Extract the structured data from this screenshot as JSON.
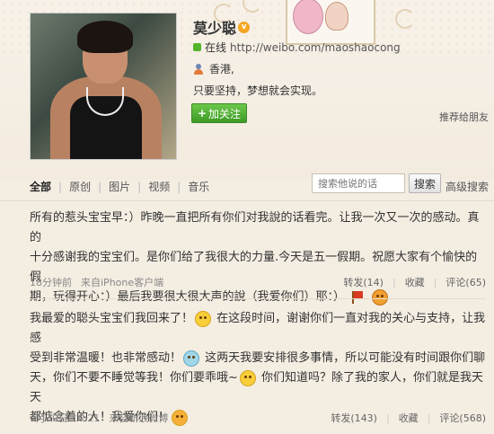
{
  "profile": {
    "name": "莫少聪",
    "verified_badge": "v",
    "online_label": "在线",
    "url": "http://weibo.com/maoshaocong",
    "location": "香港,",
    "bio": "只要坚持，梦想就会实现。",
    "follow_plus": "+",
    "follow_label": "加关注",
    "recommend_label": "推荐给朋友"
  },
  "filters": {
    "tabs": [
      "全部",
      "原创",
      "图片",
      "视频",
      "音乐"
    ],
    "search_placeholder": "搜索他说的话",
    "search_button": "搜索",
    "advanced_search": "高级搜索"
  },
  "posts": [
    {
      "lines": [
        "所有的惹头宝宝早：）昨晚一直把所有你们对我說的话看完。让我一次又一次的感动。真的",
        "十分感谢我的宝宝们。是你们给了我很大的力量.今天是五一假期。祝愿大家有个愉快的假",
        "期，玩得开心：）最后我要很大很大声的說（我爱你们）耶：）"
      ],
      "time": "18分钟前",
      "source": "来自iPhone客户端",
      "repost": "转发(14)",
      "favorite": "收藏",
      "comment": "评论(65)"
    },
    {
      "segments": [
        "我最爱的聪头宝宝们我回来了！",
        "在这段时间，谢谢你们一直对我的关心与支持，让我感",
        "受到非常温暖！也非常感动！",
        "这两天我要安排很多事情，所以可能没有时间跟你们聊",
        "天，你们不要不睡觉等我！你们要乖哦~",
        "你们知道吗？除了我的家人，你们就是我天天",
        "都惦念着的人！我爱你们！"
      ],
      "time": "4月30日 16:21",
      "source": "来自新浪微博",
      "repost": "转发(143)",
      "favorite": "收藏",
      "comment": "评论(568)"
    }
  ],
  "colors": {
    "background": "#f4ede2",
    "follow_green": "#3d9a26",
    "online_green": "#52b52b",
    "badge_orange": "#f5a623"
  }
}
